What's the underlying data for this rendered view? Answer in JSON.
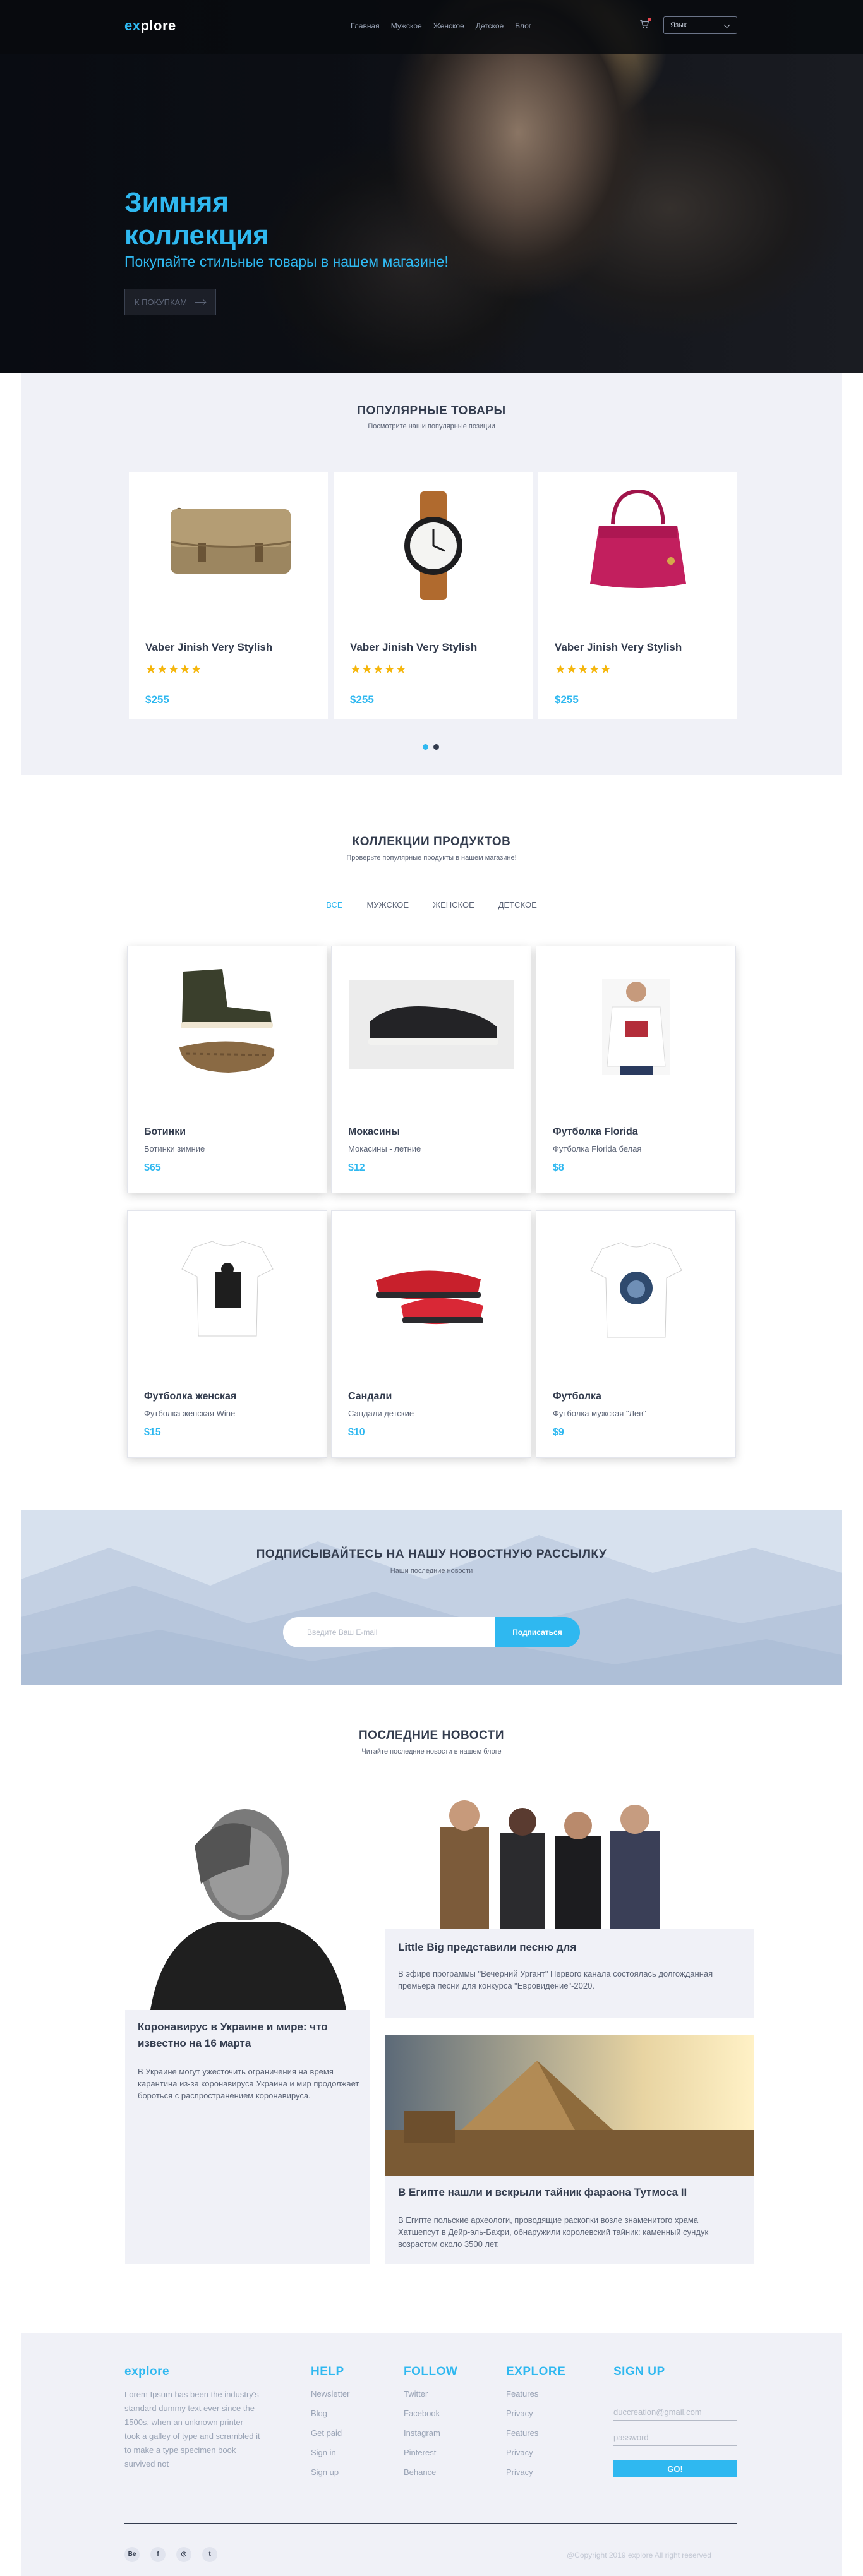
{
  "header": {
    "logo_prefix": "ex",
    "logo_rest": "plore",
    "nav": [
      "Главная",
      "Мужское",
      "Женское",
      "Детское",
      "Блог"
    ],
    "language": "Язык"
  },
  "hero": {
    "title_line1": "Зимняя",
    "title_line2": "коллекция",
    "subtitle": "Покупайте стильные товары в нашем магазине!",
    "button": "К ПОКУПКАМ"
  },
  "popular": {
    "title": "ПОПУЛЯРНЫЕ ТОВАРЫ",
    "subtitle": "Посмотрите наши популярные позиции",
    "items": [
      {
        "name": "Vaber Jinish Very Stylish",
        "price": "$255",
        "rating": 5,
        "image": "messenger-bag"
      },
      {
        "name": "Vaber Jinish Very Stylish",
        "price": "$255",
        "rating": 5,
        "image": "wrist-watch"
      },
      {
        "name": "Vaber Jinish Very Stylish",
        "price": "$255",
        "rating": 5,
        "image": "pink-handbag"
      }
    ],
    "star_char": "★★★★★"
  },
  "collections": {
    "title": "КОЛЛЕКЦИИ ПРОДУКТОВ",
    "subtitle": "Проверьте популярные продукты в нашем магазине!",
    "tabs": [
      "ВСЕ",
      "МУЖСКОЕ",
      "ЖЕНСКОЕ",
      "ДЕТСКОЕ"
    ],
    "active_tab": "ВСЕ",
    "items": [
      {
        "name": "Ботинки",
        "desc": "Ботинки зимние",
        "price": "$65"
      },
      {
        "name": "Мокасины",
        "desc": "Мокасины - летние",
        "price": "$12"
      },
      {
        "name": "Футболка Florida",
        "desc": "Футболка Florida белая",
        "price": "$8"
      },
      {
        "name": "Футболка женская",
        "desc": "Футболка женская Wine",
        "price": "$15"
      },
      {
        "name": "Сандали",
        "desc": "Сандали детские",
        "price": "$10"
      },
      {
        "name": "Футболка",
        "desc": "Футболка мужская \"Лев\"",
        "price": "$9"
      }
    ]
  },
  "newsletter": {
    "title": "ПОДПИСЫВАЙТЕСЬ НА НАШУ НОВОСТНУЮ РАССЫЛКУ",
    "subtitle": "Наши последние новости",
    "placeholder": "Введите Ваш E-mail",
    "button": "Подписаться"
  },
  "news": {
    "title": "ПОСЛЕДНИЕ НОВОСТИ",
    "subtitle": "Читайте последние новости в нашем блоге",
    "articles": [
      {
        "title": "Коронавирус в Украине и мире: что известно на 16 марта",
        "text": "В Украине могут ужесточить ограничения на время карантина из-за коронавируса Украина и мир продолжает бороться с распространением коронавируса."
      },
      {
        "title": "Little Big представили песню для",
        "text": "В эфире программы \"Вечерний Ургант\" Первого канала состоялась долгожданная премьера песни для конкурса \"Евровидение\"-2020."
      },
      {
        "title": "В Египте нашли и вскрыли тайник фараона Тутмоса II",
        "text": "В Египте польские археологи, проводящие раскопки возле знаменитого храма Хатшепсут в Дейр-эль-Бахри, обнаружили королевский тайник: каменный сундук возрастом около 3500 лет."
      }
    ]
  },
  "footer": {
    "brand": "explore",
    "about": "Lorem Ipsum has been the industry's standard dummy text ever since the 1500s, when an unknown printer took a galley of type and scrambled it to make a type specimen book survived not",
    "help": {
      "title": "HELP",
      "links": [
        "Newsletter",
        "Blog",
        "Get paid",
        "Sign in",
        "Sign up"
      ]
    },
    "follow": {
      "title": "FOLLOW",
      "links": [
        "Twitter",
        "Facebook",
        "Instagram",
        "Pinterest",
        "Behance"
      ]
    },
    "explore": {
      "title": "EXPLORE",
      "links": [
        "Features",
        "Privacy",
        "Features",
        "Privacy",
        "Privacy"
      ]
    },
    "signup": {
      "title": "SIGN UP",
      "email_placeholder": "duccreation@gmail.com",
      "password_placeholder": "password",
      "button": "GO!"
    },
    "social": [
      "Be",
      "f",
      "◎",
      "t"
    ],
    "copyright": "@Copyright 2019 explore All right reserved"
  },
  "colors": {
    "accent": "#2fb8f0",
    "dark": "#333c4e",
    "star": "#f5b60c",
    "light_bg": "#f0f1f7"
  }
}
